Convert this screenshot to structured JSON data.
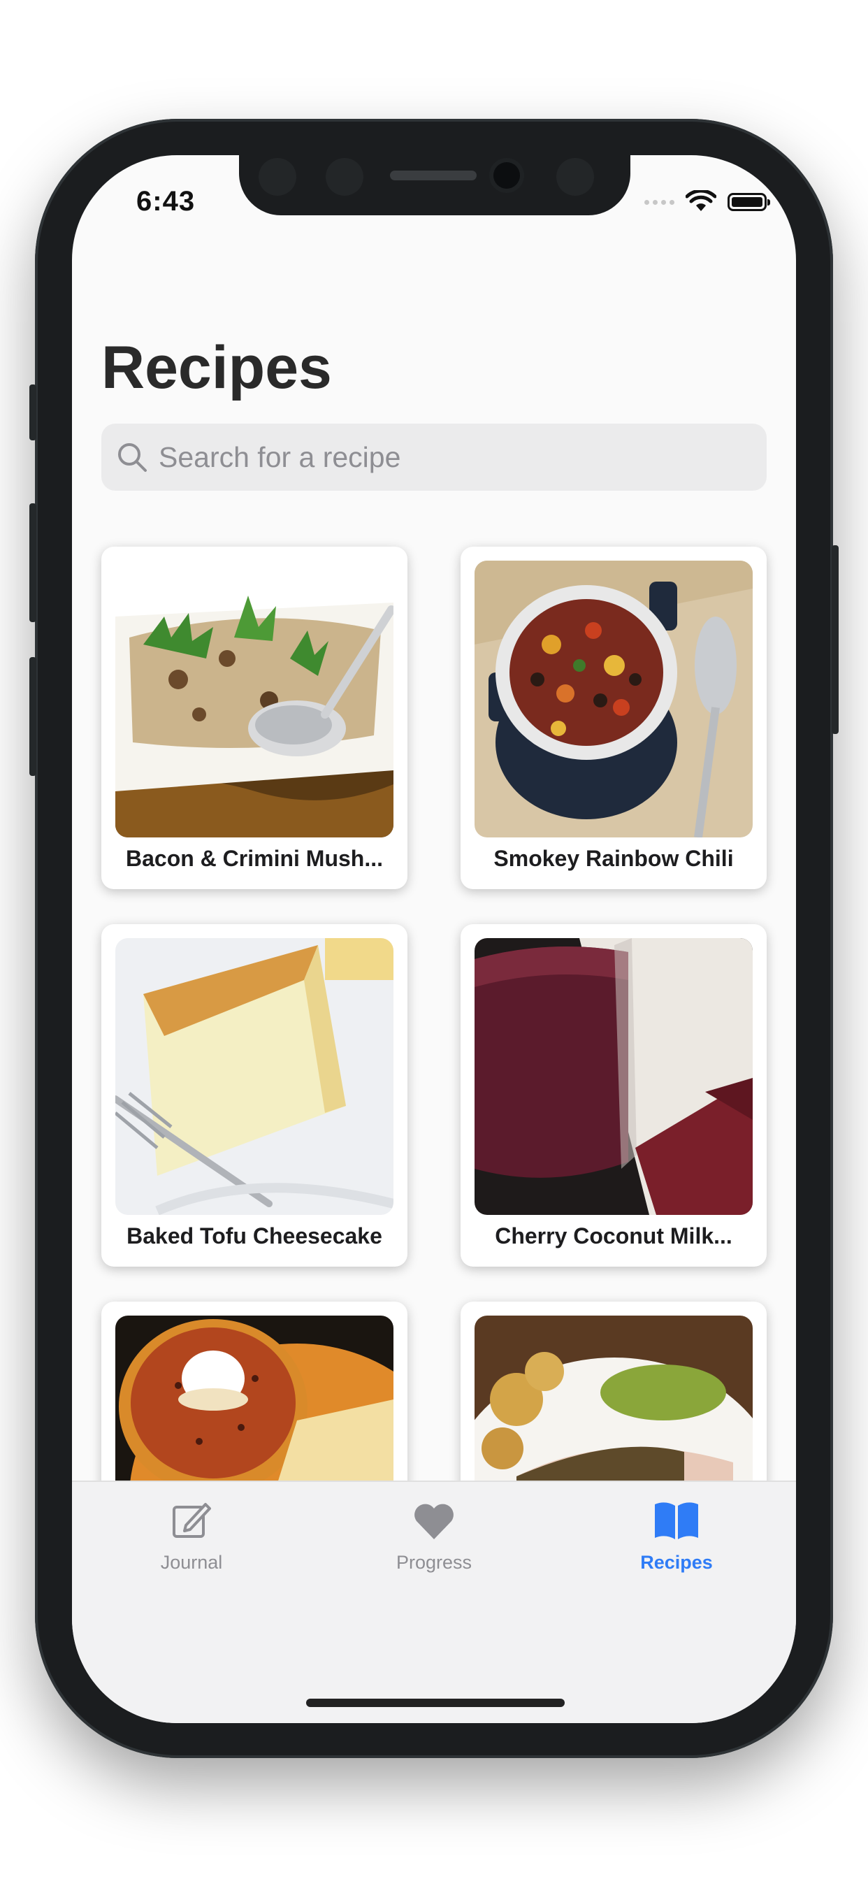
{
  "status_bar": {
    "time": "6:43"
  },
  "header": {
    "title": "Recipes"
  },
  "search": {
    "placeholder": "Search for a recipe",
    "value": ""
  },
  "recipes": [
    {
      "name": "Bacon & Crimini Mush..."
    },
    {
      "name": "Smokey Rainbow Chili"
    },
    {
      "name": "Baked Tofu Cheesecake"
    },
    {
      "name": "Cherry Coconut Milk..."
    },
    {
      "name": ""
    },
    {
      "name": ""
    }
  ],
  "tabs": [
    {
      "label": "Journal",
      "icon": "compose-icon",
      "active": false
    },
    {
      "label": "Progress",
      "icon": "heart-icon",
      "active": false
    },
    {
      "label": "Recipes",
      "icon": "book-icon",
      "active": true
    }
  ],
  "colors": {
    "accent": "#2f7cf6",
    "inactive": "#8e8e93"
  }
}
